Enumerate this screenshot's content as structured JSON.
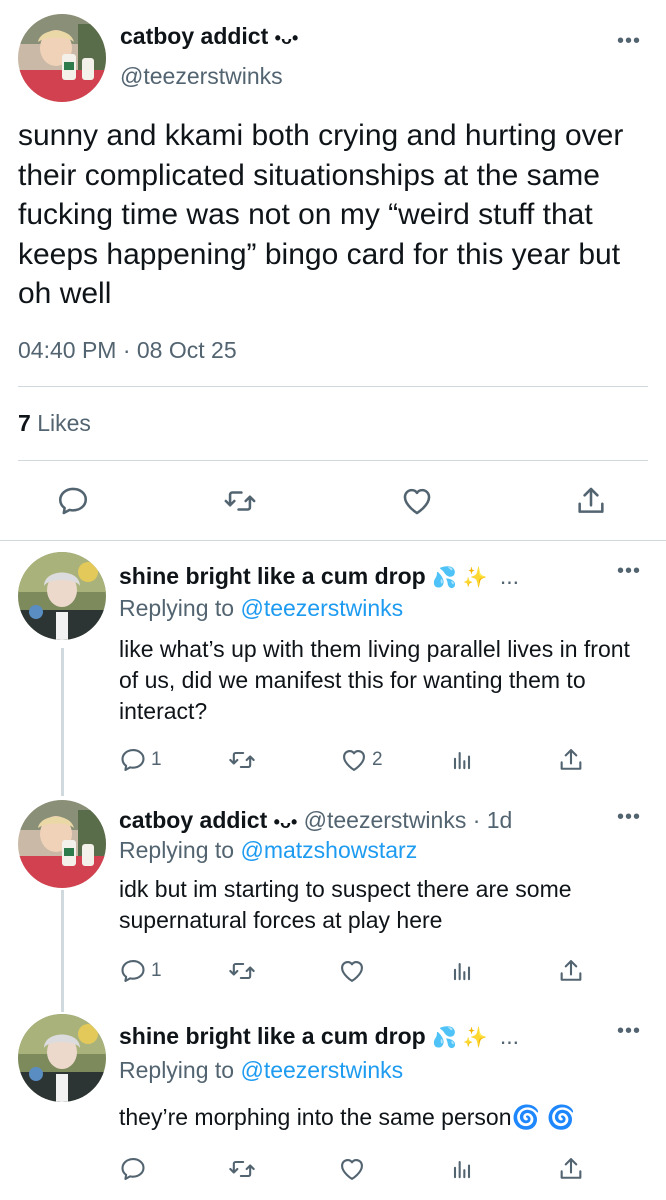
{
  "main_tweet": {
    "display_name": "catboy addict",
    "name_emoticon": "•ᴗ•",
    "handle": "@teezerstwinks",
    "text": "sunny and kkami both crying and hurting over their complicated situationships at the same fucking time was not on my “weird stuff that keeps happening” bingo card for this year but oh well",
    "timestamp": "04:40 PM · 08 Oct 25",
    "likes_count": "7",
    "likes_label": "Likes"
  },
  "replies": [
    {
      "display_name": "shine bright like a cum drop",
      "name_emoji": "💦 ✨",
      "ellipsis": "...",
      "handle_time": "",
      "replying_prefix": "Replying to",
      "replying_to": "@teezerstwinks",
      "text": "like what’s up with them living parallel lives in front of us, did we manifest this for wanting them to interact?",
      "reply_count": "1",
      "retweet_count": "",
      "like_count": "2"
    },
    {
      "display_name": "catboy addict",
      "name_emoticon": "•ᴗ•",
      "handle_time": "@teezerstwinks · 1d",
      "replying_prefix": "Replying to",
      "replying_to": "@matzshowstarz",
      "text": "idk but im starting to suspect there are some supernatural forces at play here",
      "reply_count": "1",
      "retweet_count": "",
      "like_count": ""
    },
    {
      "display_name": "shine bright like a cum drop",
      "name_emoji": "💦 ✨",
      "ellipsis": "...",
      "replying_prefix": "Replying to",
      "replying_to": "@teezerstwinks",
      "text": "they’re morphing into the same person🌀 🌀",
      "reply_count": "",
      "retweet_count": "",
      "like_count": ""
    }
  ],
  "icons": {
    "more": "more-dots-icon",
    "reply": "reply-bubble-icon",
    "retweet": "retweet-icon",
    "like": "heart-icon",
    "share": "share-icon",
    "views": "views-chart-icon"
  },
  "colors": {
    "text": "#0f1419",
    "muted": "#536471",
    "link": "#1d9bf0",
    "divider": "#cfd9de"
  }
}
